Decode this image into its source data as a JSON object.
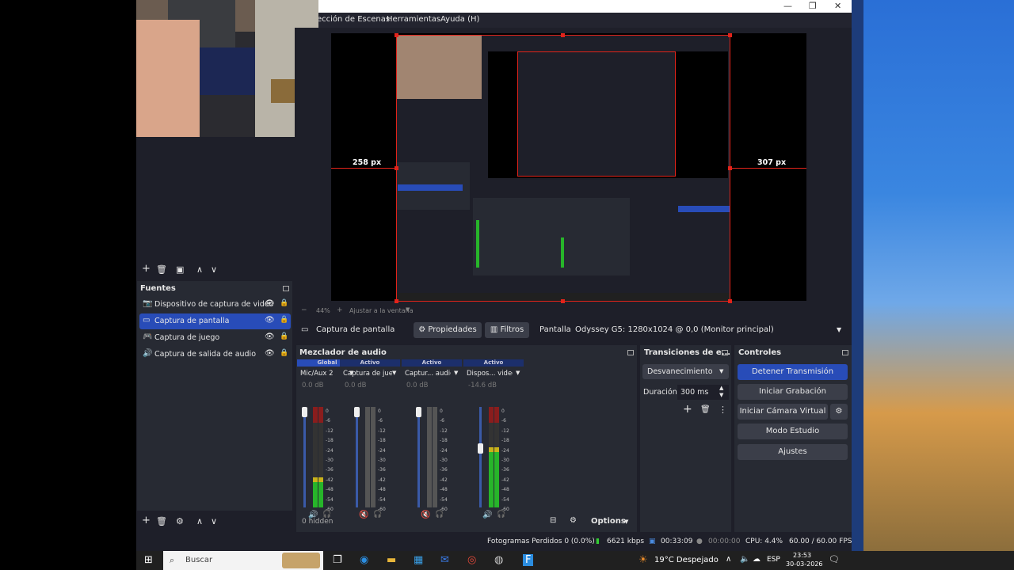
{
  "window": {
    "minimize": "—",
    "maximize": "❐",
    "close": "✕"
  },
  "menu": {
    "items": [
      "ección de Escenas",
      "Herramientas",
      "Ayuda (H)"
    ]
  },
  "scene_toolbar": {
    "add": "+",
    "remove": "🗑",
    "filter": "▣",
    "up": "∧",
    "down": "∨"
  },
  "sources": {
    "title": "Fuentes",
    "items": [
      {
        "label": "Dispositivo de captura de video",
        "icon": "camera-icon",
        "glyph": "📷"
      },
      {
        "label": "Captura de pantalla",
        "icon": "monitor-icon",
        "glyph": "▭",
        "selected": true
      },
      {
        "label": "Captura de juego",
        "icon": "gamepad-icon",
        "glyph": "🎮"
      },
      {
        "label": "Captura de salida de audio",
        "icon": "speaker-icon",
        "glyph": "🔊"
      }
    ],
    "toolbar": {
      "add": "+",
      "remove": "🗑",
      "settings": "⚙",
      "up": "∧",
      "down": "∨"
    }
  },
  "preview": {
    "left_px": "258 px",
    "right_px": "307 px",
    "zoom_minus": "−",
    "zoom": "44%",
    "zoom_plus": "+",
    "fit": "Ajustar a la ventana"
  },
  "props_bar": {
    "source_name": "Captura de pantalla",
    "properties": "Propiedades",
    "filters": "Filtros",
    "display_label": "Pantalla",
    "display_value": "Odyssey G5: 1280x1024 @ 0,0 (Monitor principal)"
  },
  "mixer": {
    "title": "Mezclador de audio",
    "channels": [
      {
        "tag": "Global",
        "name": "Mic/Aux 2",
        "db": "0.0 dB",
        "level": 0.25,
        "slider": 1.0,
        "muted": false
      },
      {
        "tag": "Activo",
        "name": "Captura de juego",
        "db": "0.0 dB",
        "level": 0.0,
        "slider": 1.0,
        "muted": true
      },
      {
        "tag": "Activo",
        "name": "Captur... audio",
        "db": "0.0 dB",
        "level": 0.0,
        "slider": 1.0,
        "muted": true
      },
      {
        "tag": "Activo",
        "name": "Dispos... video",
        "db": "-14.6 dB",
        "level": 0.55,
        "slider": 0.6,
        "muted": false
      }
    ],
    "ticks": [
      "0",
      "-6",
      "-12",
      "-18",
      "-24",
      "-30",
      "-36",
      "-42",
      "-48",
      "-54",
      "-60"
    ],
    "hidden": "0 hidden",
    "options": "Options"
  },
  "transitions": {
    "title": "Transiciones de e...",
    "type": "Desvanecimiento",
    "duration_label": "Duración",
    "duration_value": "300 ms"
  },
  "controls": {
    "title": "Controles",
    "stop_stream": "Detener Transmisión",
    "start_recording": "Iniciar Grabación",
    "start_virtual_cam": "Iniciar Cámara Virtual",
    "studio_mode": "Modo Estudio",
    "settings": "Ajustes"
  },
  "status": {
    "dropped_frames": "Fotogramas Perdidos 0 (0.0%)",
    "bitrate": "6621 kbps",
    "stream_time": "00:33:09",
    "rec_time": "00:00:00",
    "cpu": "CPU: 4.4%",
    "fps": "60.00 / 60.00 FPS"
  },
  "taskbar": {
    "search": "Buscar",
    "weather": "19°C  Despejado",
    "lang": "ESP",
    "time": "23:53",
    "date": "30-03-2026"
  },
  "colors": {
    "accent": "#284cb8",
    "selection_red": "#e2231a",
    "panel": "#272a33",
    "background": "#1e1f29"
  }
}
